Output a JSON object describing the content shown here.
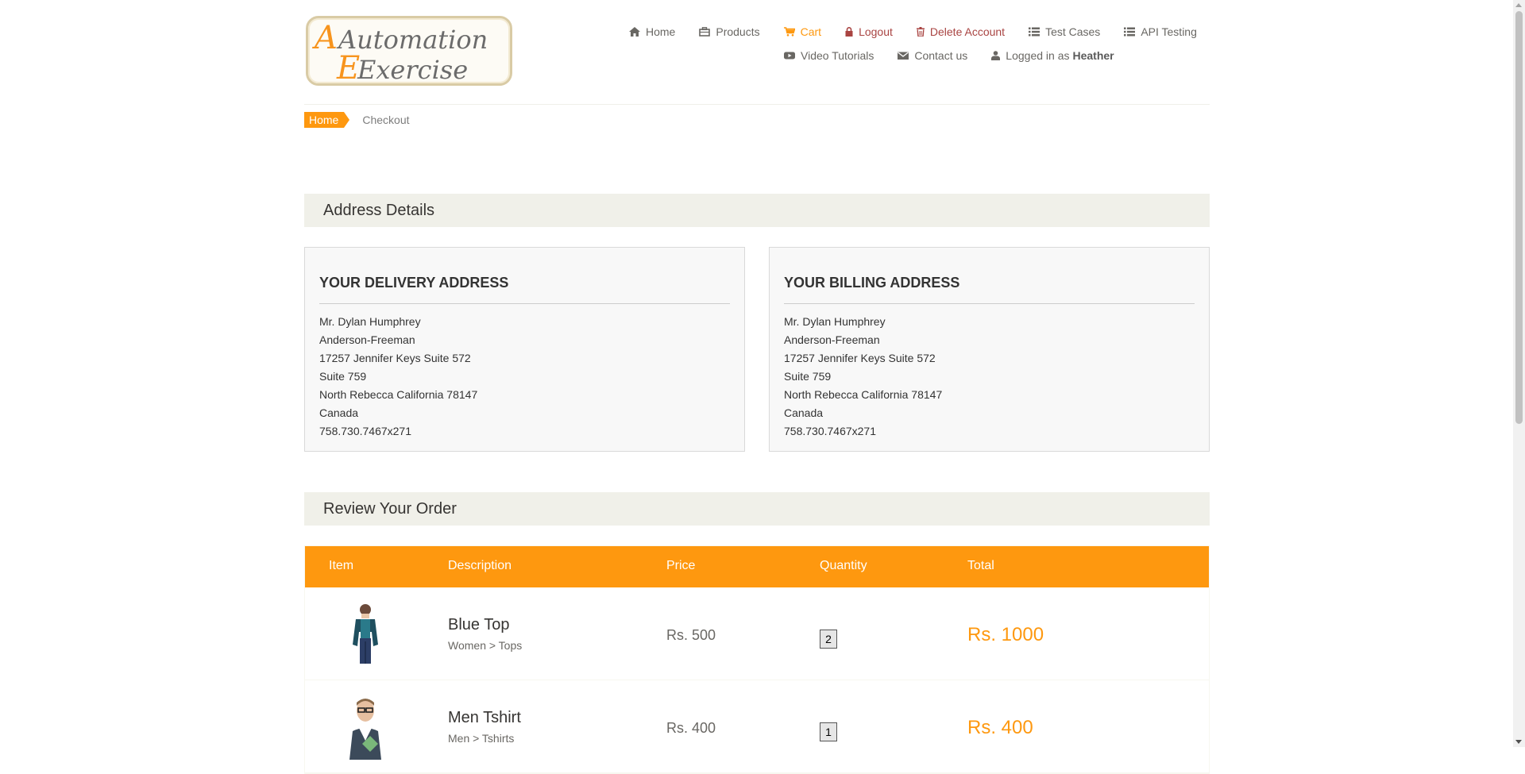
{
  "logo": {
    "line1": "Automation",
    "line2": "Exercise"
  },
  "nav": {
    "row1": [
      {
        "label": "Home",
        "icon": "home-icon",
        "state": "normal"
      },
      {
        "label": "Products",
        "icon": "products-icon",
        "state": "normal"
      },
      {
        "label": "Cart",
        "icon": "cart-icon",
        "state": "active"
      },
      {
        "label": "Logout",
        "icon": "lock-icon",
        "state": "red"
      },
      {
        "label": "Delete Account",
        "icon": "trash-icon",
        "state": "red"
      },
      {
        "label": "Test Cases",
        "icon": "list-icon",
        "state": "normal"
      },
      {
        "label": "API Testing",
        "icon": "list-icon",
        "state": "normal"
      }
    ],
    "row2": [
      {
        "label": "Video Tutorials",
        "icon": "youtube-icon"
      },
      {
        "label": "Contact us",
        "icon": "envelope-icon"
      },
      {
        "label": "Logged in as",
        "icon": "user-icon",
        "user": "Heather"
      }
    ]
  },
  "breadcrumb": {
    "home": "Home",
    "current": "Checkout"
  },
  "address_section": {
    "title": "Address Details"
  },
  "delivery": {
    "title": "Your delivery address",
    "lines": [
      "Mr. Dylan Humphrey",
      "Anderson-Freeman",
      "17257 Jennifer Keys Suite 572",
      "Suite 759",
      "North Rebecca California 78147",
      "Canada",
      "758.730.7467x271"
    ]
  },
  "billing": {
    "title": "Your billing address",
    "lines": [
      "Mr. Dylan Humphrey",
      "Anderson-Freeman",
      "17257 Jennifer Keys Suite 572",
      "Suite 759",
      "North Rebecca California 78147",
      "Canada",
      "758.730.7467x271"
    ]
  },
  "order_section": {
    "title": "Review Your Order"
  },
  "table": {
    "headers": {
      "item": "Item",
      "description": "Description",
      "price": "Price",
      "quantity": "Quantity",
      "total": "Total"
    },
    "rows": [
      {
        "name": "Blue Top",
        "category": "Women > Tops",
        "price": "Rs. 500",
        "quantity": "2",
        "total": "Rs. 1000"
      },
      {
        "name": "Men Tshirt",
        "category": "Men > Tshirts",
        "price": "Rs. 400",
        "quantity": "1",
        "total": "Rs. 400"
      }
    ]
  },
  "colors": {
    "accent": "#FE980F",
    "danger": "#A94442",
    "panel": "#F0F0E9"
  }
}
